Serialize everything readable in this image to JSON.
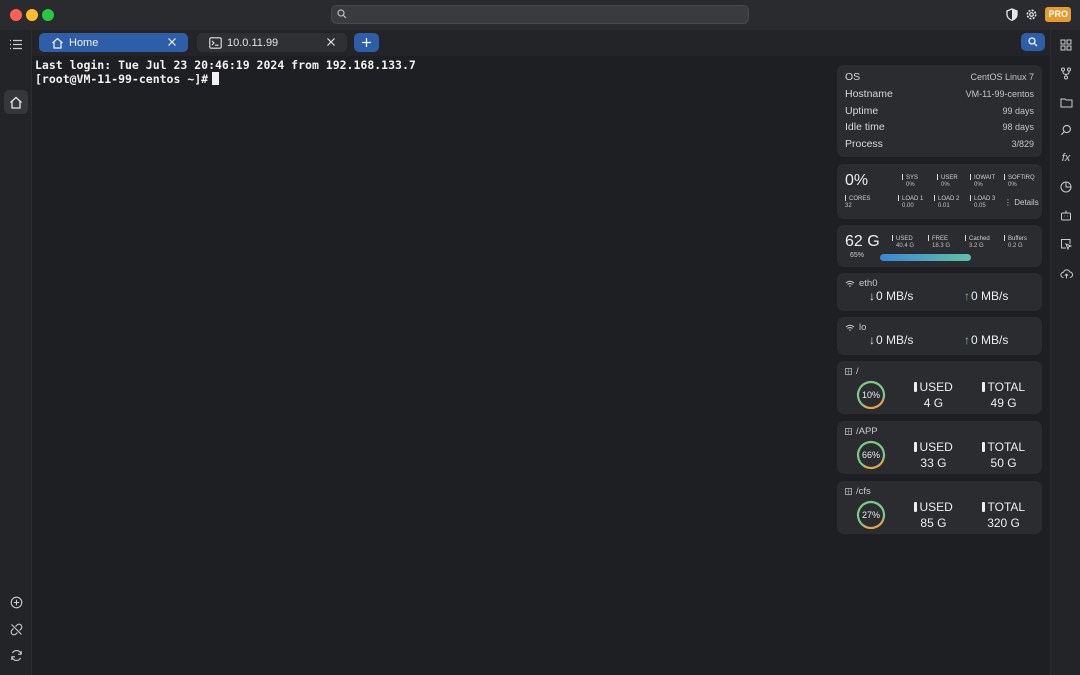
{
  "tabs": [
    {
      "label": "Home",
      "icon": "home-icon",
      "active": true
    },
    {
      "label": "10.0.11.99",
      "icon": "terminal-icon",
      "active": false
    }
  ],
  "terminal": {
    "lines": [
      "Last login: Tue Jul 23 20:46:19 2024 from 192.168.133.7",
      "[root@VM-11-99-centos ~]#"
    ]
  },
  "system": {
    "rows": [
      {
        "label": "OS",
        "value": "CentOS Linux 7"
      },
      {
        "label": "Hostname",
        "value": "VM-11-99-centos"
      },
      {
        "label": "Uptime",
        "value": "99 days"
      },
      {
        "label": "Idle time",
        "value": "98 days"
      },
      {
        "label": "Process",
        "value": "3/829"
      }
    ]
  },
  "cpu": {
    "usage": "0%",
    "stats": [
      {
        "label": "SYS",
        "value": "0%"
      },
      {
        "label": "USER",
        "value": "0%"
      },
      {
        "label": "IOWAIT",
        "value": "0%"
      },
      {
        "label": "SOFTIRQ",
        "value": "0%"
      }
    ],
    "cores": {
      "label": "CORES",
      "value": "32"
    },
    "loads": [
      {
        "label": "LOAD 1",
        "value": "0.00"
      },
      {
        "label": "LOAD 2",
        "value": "0.01"
      },
      {
        "label": "LOAD 3",
        "value": "0.05"
      }
    ],
    "details_label": "Details"
  },
  "memory": {
    "total": "62 G",
    "percent_label": "65%",
    "percent": 65,
    "stats": [
      {
        "label": "USED",
        "value": "40.4 G"
      },
      {
        "label": "FREE",
        "value": "18.3 G"
      },
      {
        "label": "Cached",
        "value": "3.2 G"
      },
      {
        "label": "Buffers",
        "value": "0.2 G"
      }
    ]
  },
  "network": [
    {
      "name": "eth0",
      "down": "0 MB/s",
      "up": "0 MB/s"
    },
    {
      "name": "lo",
      "down": "0 MB/s",
      "up": "0 MB/s"
    }
  ],
  "disks": [
    {
      "name": "/",
      "percent_label": "10%",
      "percent": 10,
      "used_label": "USED",
      "used": "4 G",
      "total_label": "TOTAL",
      "total": "49 G"
    },
    {
      "name": "/APP",
      "percent_label": "66%",
      "percent": 66,
      "used_label": "USED",
      "used": "33 G",
      "total_label": "TOTAL",
      "total": "50 G"
    },
    {
      "name": "/cfs",
      "percent_label": "27%",
      "percent": 27,
      "used_label": "USED",
      "used": "85 G",
      "total_label": "TOTAL",
      "total": "320 G"
    }
  ],
  "titlebar": {
    "pro_badge": "PRO"
  },
  "colors": {
    "accent": "#2f5ea8",
    "gauge_green": "#7ec98a",
    "gauge_orange": "#e0a550"
  }
}
